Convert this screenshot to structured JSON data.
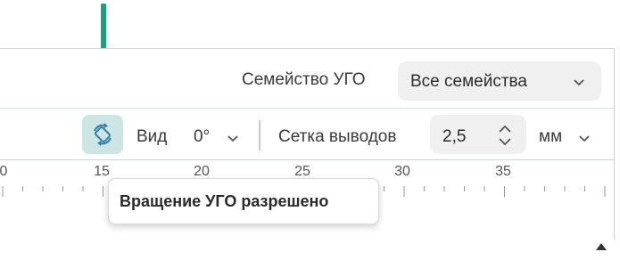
{
  "toolbar": {
    "family_label": "Семейство УГО",
    "family_select_value": "Все семейства",
    "view_label": "Вид",
    "view_value": "0°",
    "grid_label": "Сетка выводов",
    "grid_value": "2,5",
    "grid_unit": "мм"
  },
  "ruler": {
    "tick_labels": [
      "0",
      "15",
      "20",
      "25",
      "30",
      "35"
    ]
  },
  "tooltip": {
    "text": "Вращение УГО разрешено"
  },
  "colors": {
    "accent": "#17a084",
    "button_active_bg": "#cde6e3"
  },
  "icons": [
    "arrow-down-icon",
    "rotate-icon",
    "chevron-down-icon",
    "stepper-up-down-icon",
    "scroll-up-icon"
  ]
}
